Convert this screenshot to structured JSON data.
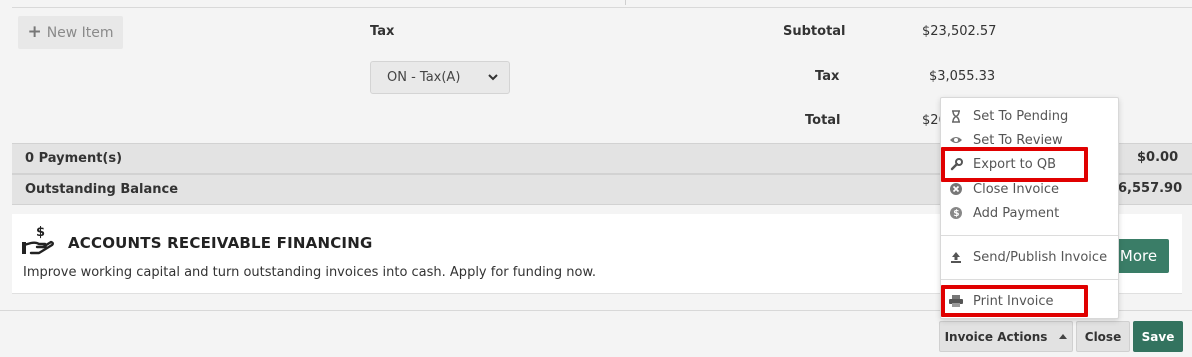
{
  "new_item_label": "New Item",
  "tax_header": "Tax",
  "tax_select_value": "ON - Tax(A)",
  "totals": {
    "subtotal_label": "Subtotal",
    "subtotal_value": "$23,502.57",
    "tax_label": "Tax",
    "tax_value": "$3,055.33",
    "total_label": "Total",
    "total_value_partial": "$26"
  },
  "payments": {
    "label": "0 Payment(s)",
    "value": "$0.00"
  },
  "outstanding": {
    "label": "Outstanding Balance",
    "value_partial": "6,557.90"
  },
  "financing": {
    "title": "ACCOUNTS RECEIVABLE FINANCING",
    "description": "Improve working capital and turn outstanding invoices into cash. Apply for funding now.",
    "more_label": "More"
  },
  "menu_items": [
    {
      "label": "Set To Pending",
      "icon": "hourglass-icon"
    },
    {
      "label": "Set To Review",
      "icon": "eye-icon"
    },
    {
      "label": "Export to QB",
      "icon": "wrench-icon"
    },
    {
      "label": "Close Invoice",
      "icon": "close-circle-icon"
    },
    {
      "label": "Add Payment",
      "icon": "dollar-coin-icon"
    },
    {
      "label": "Send/Publish Invoice",
      "icon": "upload-icon"
    },
    {
      "label": "Print Invoice",
      "icon": "printer-icon"
    }
  ],
  "actions": {
    "invoice_actions_label": "Invoice Actions",
    "close_label": "Close",
    "save_label": "Save"
  },
  "colors": {
    "accent_green": "#33735f",
    "highlight_red": "#e00000"
  }
}
